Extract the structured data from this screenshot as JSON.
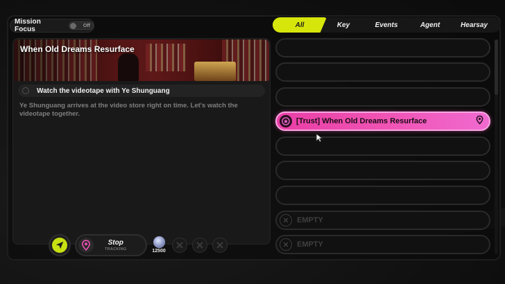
{
  "header": {
    "mission_focus_label": "Mission Focus",
    "mission_focus_state": "Off"
  },
  "tabs": [
    {
      "label": "All",
      "active": true
    },
    {
      "label": "Key",
      "active": false
    },
    {
      "label": "Events",
      "active": false
    },
    {
      "label": "Agent",
      "active": false
    },
    {
      "label": "Hearsay",
      "active": false
    }
  ],
  "detail": {
    "title": "When Old Dreams Resurface",
    "objective": "Watch the videotape with Ye Shunguang",
    "description": "Ye Shunguang arrives at the video store right on time. Let's watch the videotape together."
  },
  "controls": {
    "stop_label": "Stop",
    "tracking_label": "TRACKING",
    "reward_amount": "12500"
  },
  "quests": {
    "active_title": "[Trust] When Old Dreams Resurface",
    "empty_label_1": "EMPTY",
    "empty_label_2": "EMPTY"
  },
  "colors": {
    "accent_yellow": "#d7e60a",
    "active_pink": "#f053b3",
    "nav_green": "#c7e012"
  }
}
